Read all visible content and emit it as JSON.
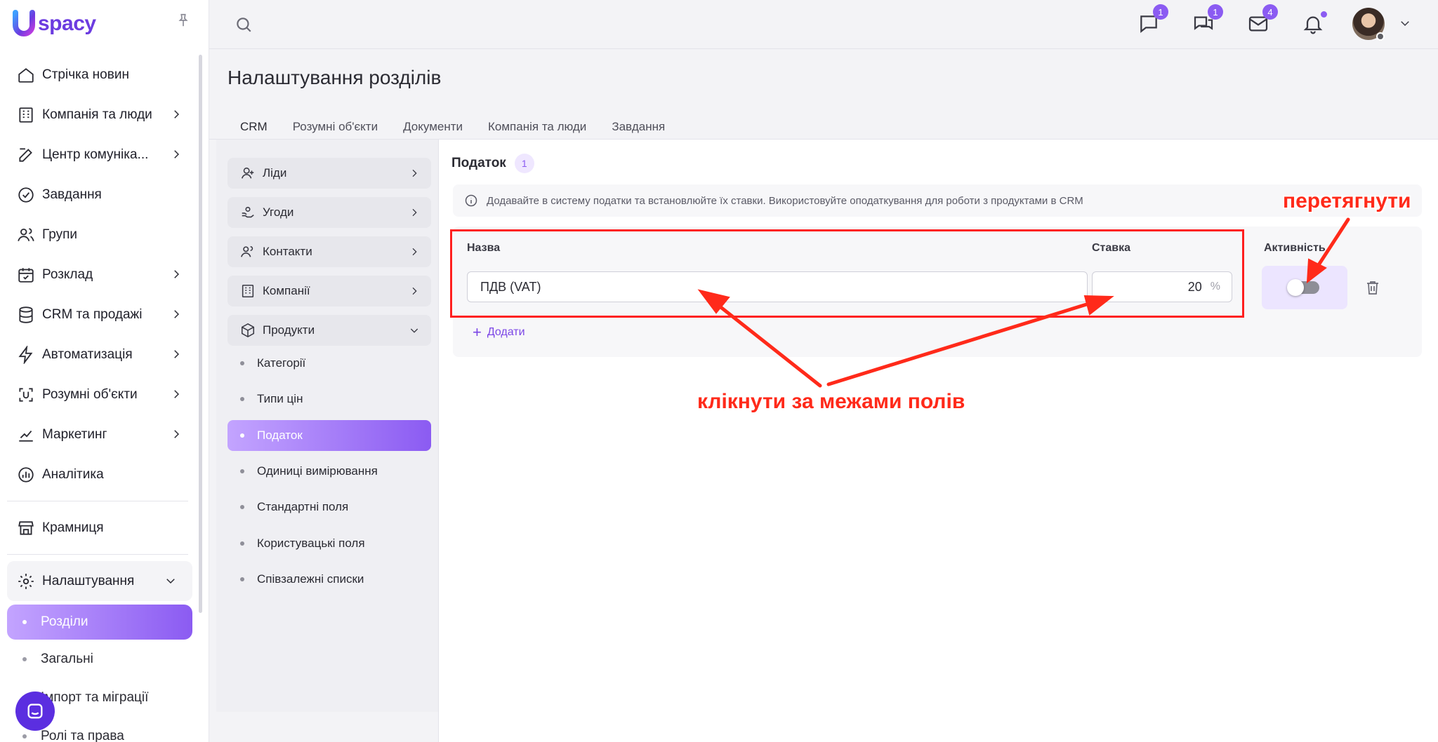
{
  "logo": {
    "text": "spacy"
  },
  "sidebar": {
    "items": [
      {
        "label": "Стрічка новин",
        "icon": "home-icon",
        "chevron": false
      },
      {
        "label": "Компанія та люди",
        "icon": "building-icon",
        "chevron": true
      },
      {
        "label": "Центр комуніка...",
        "icon": "edit-icon",
        "chevron": true
      },
      {
        "label": "Завдання",
        "icon": "check-circle-icon",
        "chevron": false
      },
      {
        "label": "Групи",
        "icon": "users-icon",
        "chevron": false
      },
      {
        "label": "Розклад",
        "icon": "calendar-icon",
        "chevron": true
      },
      {
        "label": "CRM та продажі",
        "icon": "database-icon",
        "chevron": true
      },
      {
        "label": "Автоматизація",
        "icon": "lightning-icon",
        "chevron": true
      },
      {
        "label": "Розумні об'єкти",
        "icon": "smart-object-icon",
        "chevron": true
      },
      {
        "label": "Маркетинг",
        "icon": "marketing-icon",
        "chevron": true
      },
      {
        "label": "Аналітика",
        "icon": "analytics-icon",
        "chevron": false
      }
    ],
    "store": {
      "label": "Крамниця",
      "icon": "store-icon"
    },
    "settings": {
      "label": "Налаштування",
      "icon": "gear-icon"
    },
    "settings_sub": [
      {
        "label": "Розділи",
        "active": true
      },
      {
        "label": "Загальні",
        "active": false
      },
      {
        "label": "Імпорт та міграції",
        "active": false
      },
      {
        "label": "Ролі та права",
        "active": false
      }
    ]
  },
  "topbar": {
    "badges": {
      "chat": "1",
      "comments": "1",
      "mail": "4"
    }
  },
  "page": {
    "title": "Налаштування розділів",
    "tabs": [
      "CRM",
      "Розумні об'єкти",
      "Документи",
      "Компанія та люди",
      "Завдання"
    ],
    "active_tab": "CRM"
  },
  "left_menu": {
    "groups": [
      {
        "label": "Ліди",
        "icon": "lead-icon"
      },
      {
        "label": "Угоди",
        "icon": "deal-icon"
      },
      {
        "label": "Контакти",
        "icon": "contacts-icon"
      },
      {
        "label": "Компанії",
        "icon": "company-icon"
      },
      {
        "label": "Продукти",
        "icon": "box-icon",
        "expanded": true
      }
    ],
    "products_sub": [
      {
        "label": "Категорії",
        "active": false
      },
      {
        "label": "Типи цін",
        "active": false
      },
      {
        "label": "Податок",
        "active": true
      },
      {
        "label": "Одиниці вимірювання",
        "active": false
      },
      {
        "label": "Стандартні поля",
        "active": false
      },
      {
        "label": "Користувацькі поля",
        "active": false
      },
      {
        "label": "Співзалежні списки",
        "active": false
      }
    ]
  },
  "tax": {
    "title": "Податок",
    "count": "1",
    "info": "Додавайте в систему податки та встановлюйте їх ставки. Використовуйте оподаткування для роботи з продуктами в CRM",
    "col_name": "Назва",
    "col_rate": "Ставка",
    "col_active": "Активність",
    "row": {
      "name": "ПДВ (VAT)",
      "rate": "20",
      "unit": "%",
      "active": false
    },
    "add_label": "Додати"
  },
  "annotations": {
    "drag": "перетягнути",
    "click_outside": "клікнути за межами полів"
  },
  "colors": {
    "accent": "#8b5bf2",
    "annotation": "#ff2a1a"
  }
}
